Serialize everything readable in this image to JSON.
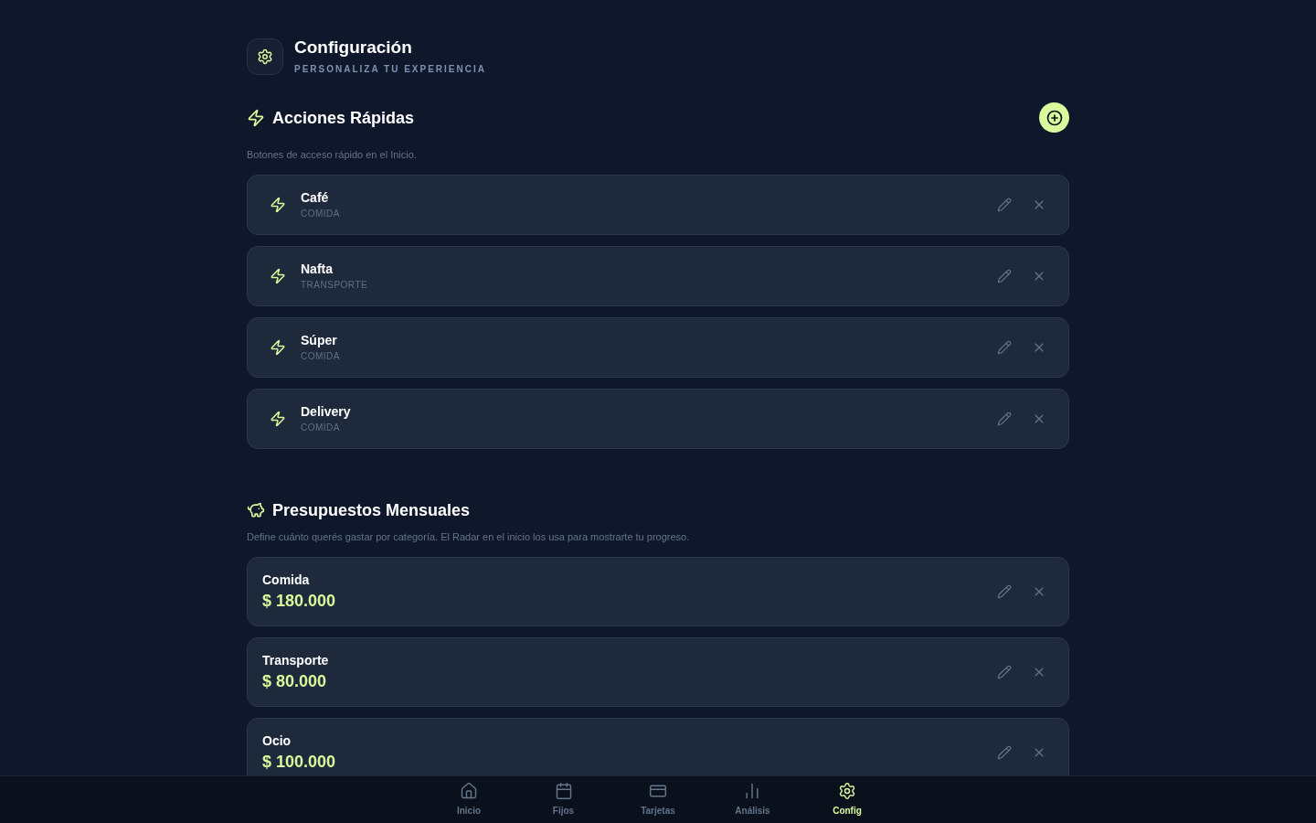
{
  "header": {
    "title": "Configuración",
    "subtitle": "PERSONALIZA TU EXPERIENCIA"
  },
  "sections": [
    {
      "kind": "quick_actions",
      "title": "Acciones Rápidas",
      "description": "Botones de acceso rápido en el Inicio.",
      "items": [
        {
          "name": "Café",
          "category": "COMIDA"
        },
        {
          "name": "Nafta",
          "category": "TRANSPORTE"
        },
        {
          "name": "Súper",
          "category": "COMIDA"
        },
        {
          "name": "Delivery",
          "category": "COMIDA"
        }
      ]
    },
    {
      "kind": "budgets",
      "title": "Presupuestos Mensuales",
      "description": "Define cuánto querés gastar por categoría. El Radar en el inicio los usa para mostrarte tu progreso.",
      "items": [
        {
          "name": "Comida",
          "amount": "$ 180.000"
        },
        {
          "name": "Transporte",
          "amount": "$ 80.000"
        },
        {
          "name": "Ocio",
          "amount": "$ 100.000"
        }
      ]
    }
  ],
  "nav": [
    {
      "label": "Inicio",
      "kind": "home",
      "selected": false
    },
    {
      "label": "Fijos",
      "kind": "calendar",
      "selected": false
    },
    {
      "label": "Tarjetas",
      "kind": "card",
      "selected": false
    },
    {
      "label": "Análisis",
      "kind": "chart",
      "selected": false
    },
    {
      "label": "Config",
      "kind": "settings",
      "selected": true
    }
  ]
}
